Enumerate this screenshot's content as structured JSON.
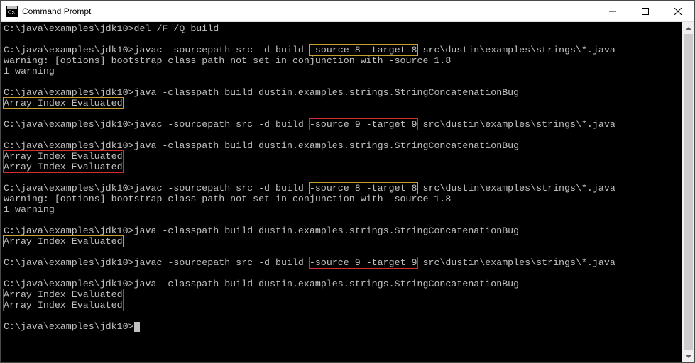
{
  "window": {
    "title": "Command Prompt"
  },
  "terminal": {
    "prompt": "C:\\java\\examples\\jdk10>",
    "cmd_del": "del /F /Q build",
    "cmd_javac_pre": "javac -sourcepath src -d build ",
    "cmd_javac_post": " src\\dustin\\examples\\strings\\*.java",
    "flag_source8": "-source 8 -target 8",
    "flag_source9": "-source 9 -target 9",
    "warn_line": "warning: [options] bootstrap class path not set in conjunction with -source 1.8",
    "warn_count": "1 warning",
    "cmd_java": "java -classpath build dustin.examples.strings.StringConcatenationBug",
    "output_eval": "Array Index Evaluated"
  }
}
